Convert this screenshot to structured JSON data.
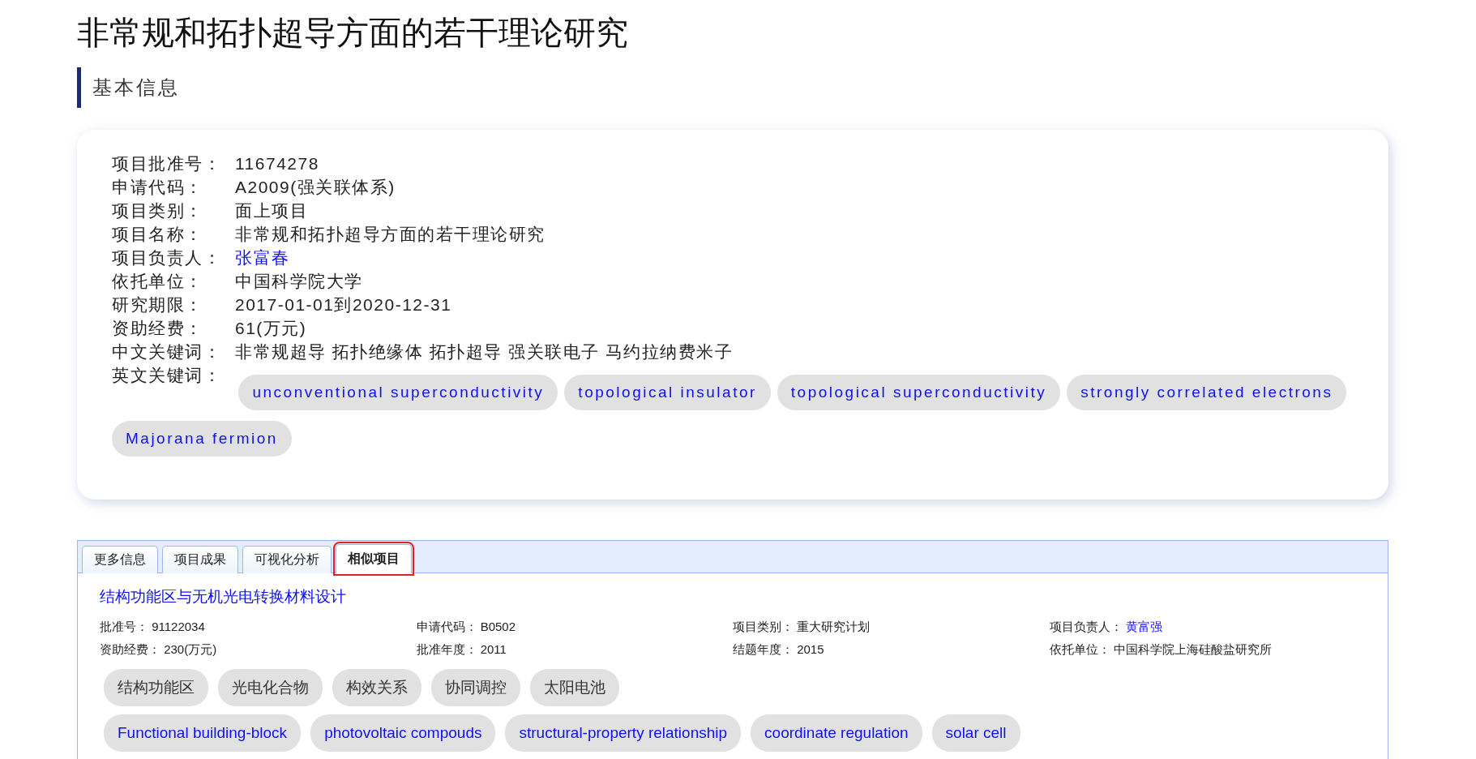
{
  "title": "非常规和拓扑超导方面的若干理论研究",
  "section_title": "基本信息",
  "info": {
    "fields": [
      {
        "label": "项目批准号：",
        "value": "11674278",
        "kind": "text"
      },
      {
        "label": "申请代码：",
        "value": "A2009(强关联体系)",
        "kind": "text"
      },
      {
        "label": "项目类别：",
        "value": "面上项目",
        "kind": "text"
      },
      {
        "label": "项目名称：",
        "value": "非常规和拓扑超导方面的若干理论研究",
        "kind": "text"
      },
      {
        "label": "项目负责人：",
        "value": "张富春",
        "kind": "link"
      },
      {
        "label": "依托单位：",
        "value": "中国科学院大学",
        "kind": "text"
      },
      {
        "label": "研究期限：",
        "value": "2017-01-01到2020-12-31",
        "kind": "text"
      },
      {
        "label": "资助经费：",
        "value": "61(万元)",
        "kind": "text"
      },
      {
        "label": "中文关键词：",
        "value": "非常规超导 拓扑绝缘体 拓扑超导 强关联电子 马约拉纳费米子",
        "kind": "text"
      }
    ],
    "en_keywords_label": "英文关键词：",
    "en_keywords": [
      "unconventional superconductivity",
      "topological insulator",
      "topological superconductivity",
      "strongly correlated electrons",
      "Majorana fermion"
    ]
  },
  "tabs": [
    {
      "label": "更多信息",
      "selected": false,
      "highlighted": false
    },
    {
      "label": "项目成果",
      "selected": false,
      "highlighted": false
    },
    {
      "label": "可视化分析",
      "selected": false,
      "highlighted": false
    },
    {
      "label": "相似项目",
      "selected": true,
      "highlighted": true
    }
  ],
  "similar_projects": [
    {
      "title": "结构功能区与无机光电转换材料设计",
      "fields": [
        {
          "label": "批准号：",
          "value": "91122034",
          "kind": "text"
        },
        {
          "label": "申请代码：",
          "value": "B0502",
          "kind": "text"
        },
        {
          "label": "项目类别：",
          "value": "重大研究计划",
          "kind": "text"
        },
        {
          "label": "项目负责人：",
          "value": "黄富强",
          "kind": "link"
        },
        {
          "label": "资助经费：",
          "value": "230(万元)",
          "kind": "text"
        },
        {
          "label": "批准年度：",
          "value": "2011",
          "kind": "text"
        },
        {
          "label": "结题年度：",
          "value": "2015",
          "kind": "text"
        },
        {
          "label": "依托单位：",
          "value": "中国科学院上海硅酸盐研究所",
          "kind": "text"
        }
      ],
      "cn_tags": [
        "结构功能区",
        "光电化合物",
        "构效关系",
        "协同调控",
        "太阳电池"
      ],
      "en_tags": [
        "Functional building-block",
        "photovoltaic compouds",
        "structural-property relationship",
        "coordinate regulation",
        "solar cell"
      ]
    }
  ]
}
